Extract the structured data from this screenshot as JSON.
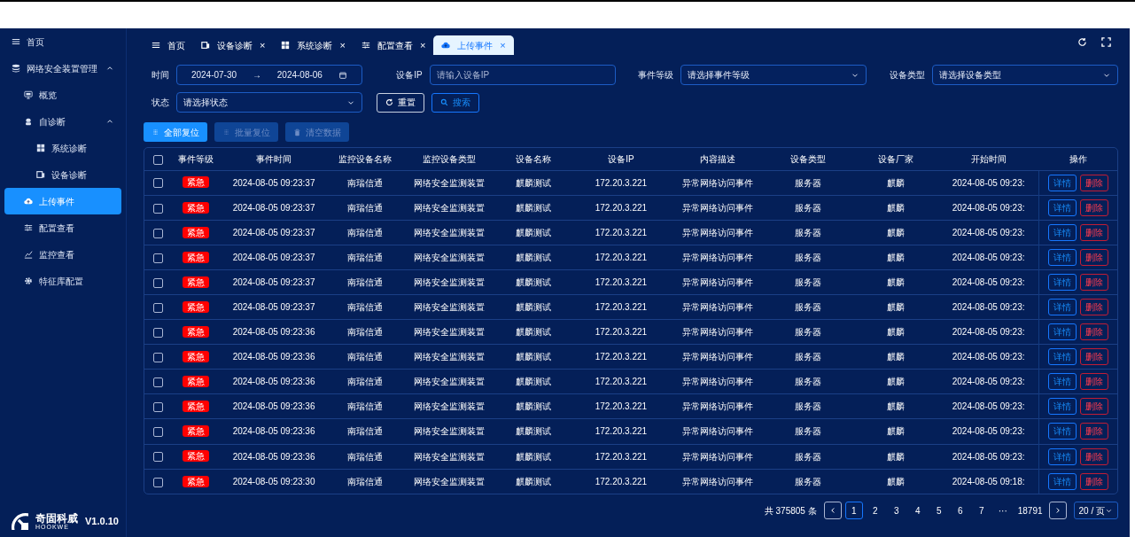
{
  "sidebar": {
    "items": [
      {
        "label": "首页",
        "kind": "menu",
        "selected": false
      },
      {
        "label": "网络安全装置管理",
        "kind": "database",
        "selected": false,
        "expanded": true,
        "children": [
          {
            "label": "概览",
            "kind": "monitor",
            "selected": false
          },
          {
            "label": "自诊断",
            "kind": "robot",
            "selected": false,
            "expanded": true,
            "children": [
              {
                "label": "系统诊断",
                "kind": "grid",
                "selected": false
              },
              {
                "label": "设备诊断",
                "kind": "device",
                "selected": false
              }
            ]
          },
          {
            "label": "上传事件",
            "kind": "cloud",
            "selected": true
          },
          {
            "label": "配置查看",
            "kind": "sliders",
            "selected": false
          },
          {
            "label": "监控查看",
            "kind": "chart",
            "selected": false
          },
          {
            "label": "特征库配置",
            "kind": "gear",
            "selected": false
          }
        ]
      }
    ],
    "logo": {
      "name": "奇固科威",
      "subtitle": "HOOKWE",
      "version": "V1.0.10"
    }
  },
  "tabs": [
    {
      "label": "首页",
      "kind": "menu",
      "closable": false,
      "selected": false
    },
    {
      "label": "设备诊断",
      "kind": "device",
      "closable": true,
      "selected": false
    },
    {
      "label": "系统诊断",
      "kind": "grid",
      "closable": true,
      "selected": false
    },
    {
      "label": "配置查看",
      "kind": "sliders",
      "closable": true,
      "selected": false
    },
    {
      "label": "上传事件",
      "kind": "cloud",
      "closable": true,
      "selected": true
    }
  ],
  "close_glyph": "×",
  "filters": {
    "time": {
      "label": "时间",
      "start": "2024-07-30",
      "arrow": "→",
      "end": "2024-08-06"
    },
    "ip": {
      "label": "设备IP",
      "placeholder": "请输入设备IP"
    },
    "level": {
      "label": "事件等级",
      "placeholder": "请选择事件等级"
    },
    "device_type": {
      "label": "设备类型",
      "placeholder": "请选择设备类型"
    },
    "status": {
      "label": "状态",
      "placeholder": "请选择状态"
    },
    "reset": "重置",
    "search": "搜索"
  },
  "actions": [
    {
      "label": "全部复位",
      "kind": "dots",
      "disabled": false
    },
    {
      "label": "批量复位",
      "kind": "dots",
      "disabled": true
    },
    {
      "label": "清空数据",
      "kind": "trash",
      "disabled": true
    }
  ],
  "table": {
    "select_all": false,
    "columns": [
      "事件等级",
      "事件时间",
      "监控设备名称",
      "监控设备类型",
      "设备名称",
      "设备IP",
      "内容描述",
      "设备类型",
      "设备厂家",
      "开始时间",
      "操作"
    ],
    "rows": [
      {
        "checked": false,
        "level": "紧急",
        "time": "2024-08-05 09:23:37",
        "monitor_name": "南瑞信通",
        "monitor_type": "网络安全监测装置",
        "device_name": "麒麟测试",
        "ip": "172.20.3.221",
        "desc": "异常网络访问事件",
        "device_type": "服务器",
        "vendor": "麒麟",
        "start": "2024-08-05 09:23:",
        "detail": "详情",
        "delete": "删除"
      },
      {
        "checked": false,
        "level": "紧急",
        "time": "2024-08-05 09:23:37",
        "monitor_name": "南瑞信通",
        "monitor_type": "网络安全监测装置",
        "device_name": "麒麟测试",
        "ip": "172.20.3.221",
        "desc": "异常网络访问事件",
        "device_type": "服务器",
        "vendor": "麒麟",
        "start": "2024-08-05 09:23:",
        "detail": "详情",
        "delete": "删除"
      },
      {
        "checked": false,
        "level": "紧急",
        "time": "2024-08-05 09:23:37",
        "monitor_name": "南瑞信通",
        "monitor_type": "网络安全监测装置",
        "device_name": "麒麟测试",
        "ip": "172.20.3.221",
        "desc": "异常网络访问事件",
        "device_type": "服务器",
        "vendor": "麒麟",
        "start": "2024-08-05 09:23:",
        "detail": "详情",
        "delete": "删除"
      },
      {
        "checked": false,
        "level": "紧急",
        "time": "2024-08-05 09:23:37",
        "monitor_name": "南瑞信通",
        "monitor_type": "网络安全监测装置",
        "device_name": "麒麟测试",
        "ip": "172.20.3.221",
        "desc": "异常网络访问事件",
        "device_type": "服务器",
        "vendor": "麒麟",
        "start": "2024-08-05 09:23:",
        "detail": "详情",
        "delete": "删除"
      },
      {
        "checked": false,
        "level": "紧急",
        "time": "2024-08-05 09:23:37",
        "monitor_name": "南瑞信通",
        "monitor_type": "网络安全监测装置",
        "device_name": "麒麟测试",
        "ip": "172.20.3.221",
        "desc": "异常网络访问事件",
        "device_type": "服务器",
        "vendor": "麒麟",
        "start": "2024-08-05 09:23:",
        "detail": "详情",
        "delete": "删除"
      },
      {
        "checked": false,
        "level": "紧急",
        "time": "2024-08-05 09:23:37",
        "monitor_name": "南瑞信通",
        "monitor_type": "网络安全监测装置",
        "device_name": "麒麟测试",
        "ip": "172.20.3.221",
        "desc": "异常网络访问事件",
        "device_type": "服务器",
        "vendor": "麒麟",
        "start": "2024-08-05 09:23:",
        "detail": "详情",
        "delete": "删除"
      },
      {
        "checked": false,
        "level": "紧急",
        "time": "2024-08-05 09:23:36",
        "monitor_name": "南瑞信通",
        "monitor_type": "网络安全监测装置",
        "device_name": "麒麟测试",
        "ip": "172.20.3.221",
        "desc": "异常网络访问事件",
        "device_type": "服务器",
        "vendor": "麒麟",
        "start": "2024-08-05 09:23:",
        "detail": "详情",
        "delete": "删除"
      },
      {
        "checked": false,
        "level": "紧急",
        "time": "2024-08-05 09:23:36",
        "monitor_name": "南瑞信通",
        "monitor_type": "网络安全监测装置",
        "device_name": "麒麟测试",
        "ip": "172.20.3.221",
        "desc": "异常网络访问事件",
        "device_type": "服务器",
        "vendor": "麒麟",
        "start": "2024-08-05 09:23:",
        "detail": "详情",
        "delete": "删除"
      },
      {
        "checked": false,
        "level": "紧急",
        "time": "2024-08-05 09:23:36",
        "monitor_name": "南瑞信通",
        "monitor_type": "网络安全监测装置",
        "device_name": "麒麟测试",
        "ip": "172.20.3.221",
        "desc": "异常网络访问事件",
        "device_type": "服务器",
        "vendor": "麒麟",
        "start": "2024-08-05 09:23:",
        "detail": "详情",
        "delete": "删除"
      },
      {
        "checked": false,
        "level": "紧急",
        "time": "2024-08-05 09:23:36",
        "monitor_name": "南瑞信通",
        "monitor_type": "网络安全监测装置",
        "device_name": "麒麟测试",
        "ip": "172.20.3.221",
        "desc": "异常网络访问事件",
        "device_type": "服务器",
        "vendor": "麒麟",
        "start": "2024-08-05 09:23:",
        "detail": "详情",
        "delete": "删除"
      },
      {
        "checked": false,
        "level": "紧急",
        "time": "2024-08-05 09:23:36",
        "monitor_name": "南瑞信通",
        "monitor_type": "网络安全监测装置",
        "device_name": "麒麟测试",
        "ip": "172.20.3.221",
        "desc": "异常网络访问事件",
        "device_type": "服务器",
        "vendor": "麒麟",
        "start": "2024-08-05 09:23:",
        "detail": "详情",
        "delete": "删除"
      },
      {
        "checked": false,
        "level": "紧急",
        "time": "2024-08-05 09:23:36",
        "monitor_name": "南瑞信通",
        "monitor_type": "网络安全监测装置",
        "device_name": "麒麟测试",
        "ip": "172.20.3.221",
        "desc": "异常网络访问事件",
        "device_type": "服务器",
        "vendor": "麒麟",
        "start": "2024-08-05 09:23:",
        "detail": "详情",
        "delete": "删除"
      },
      {
        "checked": false,
        "level": "紧急",
        "time": "2024-08-05 09:23:30",
        "monitor_name": "南瑞信通",
        "monitor_type": "网络安全监测装置",
        "device_name": "麒麟测试",
        "ip": "172.20.3.221",
        "desc": "异常网络访问事件",
        "device_type": "服务器",
        "vendor": "麒麟",
        "start": "2024-08-05 09:18:",
        "detail": "详情",
        "delete": "删除"
      }
    ]
  },
  "pagination": {
    "total": "共 375805 条",
    "pages": [
      {
        "label": "1",
        "selected": true
      },
      {
        "label": "2",
        "selected": false
      },
      {
        "label": "3",
        "selected": false
      },
      {
        "label": "4",
        "selected": false
      },
      {
        "label": "5",
        "selected": false
      },
      {
        "label": "6",
        "selected": false
      },
      {
        "label": "7",
        "selected": false
      },
      {
        "label": "···",
        "selected": false
      },
      {
        "label": "18791",
        "selected": false
      }
    ],
    "page_size": "20 / 页"
  }
}
